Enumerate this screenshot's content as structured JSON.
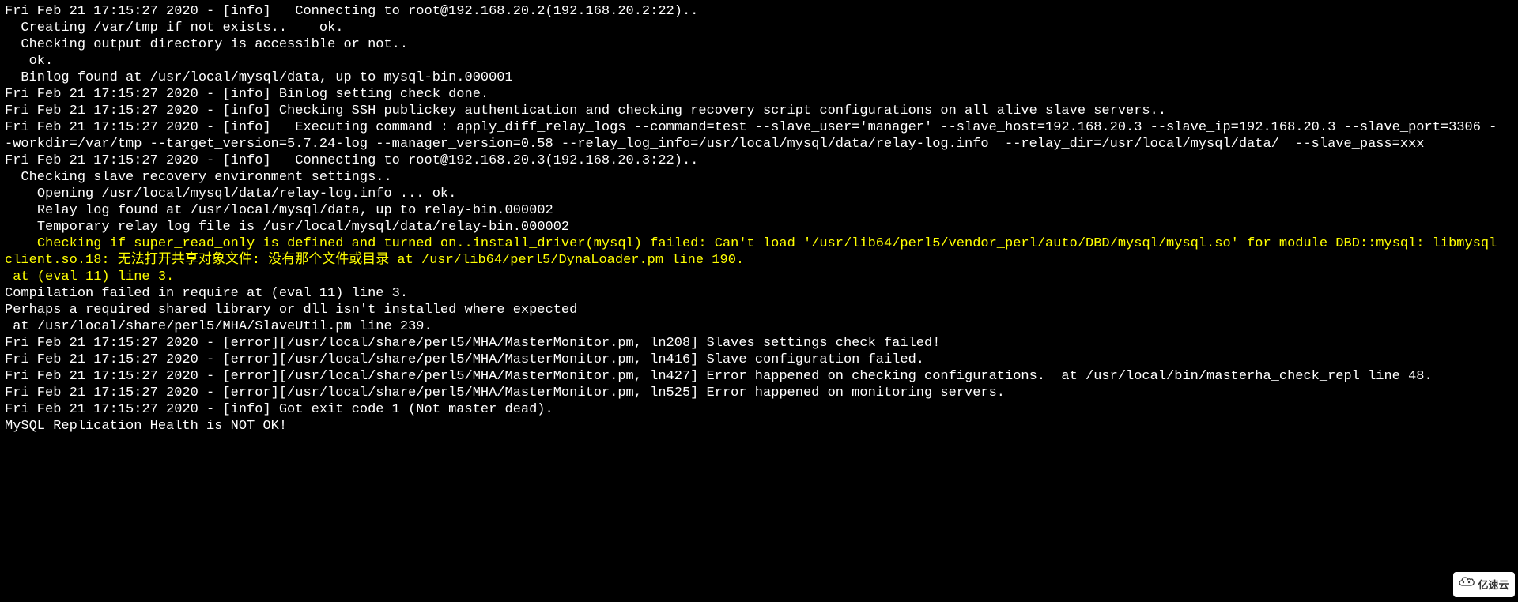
{
  "lines": [
    {
      "text": "Fri Feb 21 17:15:27 2020 - [info]   Connecting to root@192.168.20.2(192.168.20.2:22).. ",
      "cls": ""
    },
    {
      "text": "  Creating /var/tmp if not exists..    ok.",
      "cls": ""
    },
    {
      "text": "  Checking output directory is accessible or not..",
      "cls": ""
    },
    {
      "text": "   ok.",
      "cls": ""
    },
    {
      "text": "  Binlog found at /usr/local/mysql/data, up to mysql-bin.000001",
      "cls": ""
    },
    {
      "text": "Fri Feb 21 17:15:27 2020 - [info] Binlog setting check done.",
      "cls": ""
    },
    {
      "text": "Fri Feb 21 17:15:27 2020 - [info] Checking SSH publickey authentication and checking recovery script configurations on all alive slave servers..",
      "cls": ""
    },
    {
      "text": "Fri Feb 21 17:15:27 2020 - [info]   Executing command : apply_diff_relay_logs --command=test --slave_user='manager' --slave_host=192.168.20.3 --slave_ip=192.168.20.3 --slave_port=3306 --workdir=/var/tmp --target_version=5.7.24-log --manager_version=0.58 --relay_log_info=/usr/local/mysql/data/relay-log.info  --relay_dir=/usr/local/mysql/data/  --slave_pass=xxx",
      "cls": ""
    },
    {
      "text": "Fri Feb 21 17:15:27 2020 - [info]   Connecting to root@192.168.20.3(192.168.20.3:22).. ",
      "cls": ""
    },
    {
      "text": "  Checking slave recovery environment settings..",
      "cls": ""
    },
    {
      "text": "    Opening /usr/local/mysql/data/relay-log.info ... ok.",
      "cls": ""
    },
    {
      "text": "    Relay log found at /usr/local/mysql/data, up to relay-bin.000002",
      "cls": ""
    },
    {
      "text": "    Temporary relay log file is /usr/local/mysql/data/relay-bin.000002",
      "cls": ""
    },
    {
      "text": "    Checking if super_read_only is defined and turned on..install_driver(mysql) failed: Can't load '/usr/lib64/perl5/vendor_perl/auto/DBD/mysql/mysql.so' for module DBD::mysql: libmysqlclient.so.18: 无法打开共享对象文件: 没有那个文件或目录 at /usr/lib64/perl5/DynaLoader.pm line 190.",
      "cls": "yellow"
    },
    {
      "text": " at (eval 11) line 3.",
      "cls": "yellow"
    },
    {
      "text": "Compilation failed in require at (eval 11) line 3.",
      "cls": ""
    },
    {
      "text": "Perhaps a required shared library or dll isn't installed where expected",
      "cls": ""
    },
    {
      "text": " at /usr/local/share/perl5/MHA/SlaveUtil.pm line 239.",
      "cls": ""
    },
    {
      "text": "Fri Feb 21 17:15:27 2020 - [error][/usr/local/share/perl5/MHA/MasterMonitor.pm, ln208] Slaves settings check failed!",
      "cls": ""
    },
    {
      "text": "Fri Feb 21 17:15:27 2020 - [error][/usr/local/share/perl5/MHA/MasterMonitor.pm, ln416] Slave configuration failed.",
      "cls": ""
    },
    {
      "text": "Fri Feb 21 17:15:27 2020 - [error][/usr/local/share/perl5/MHA/MasterMonitor.pm, ln427] Error happened on checking configurations.  at /usr/local/bin/masterha_check_repl line 48.",
      "cls": ""
    },
    {
      "text": "Fri Feb 21 17:15:27 2020 - [error][/usr/local/share/perl5/MHA/MasterMonitor.pm, ln525] Error happened on monitoring servers.",
      "cls": ""
    },
    {
      "text": "Fri Feb 21 17:15:27 2020 - [info] Got exit code 1 (Not master dead).",
      "cls": ""
    },
    {
      "text": "",
      "cls": ""
    },
    {
      "text": "MySQL Replication Health is NOT OK!",
      "cls": ""
    }
  ],
  "watermark": {
    "brand": "亿速云"
  }
}
